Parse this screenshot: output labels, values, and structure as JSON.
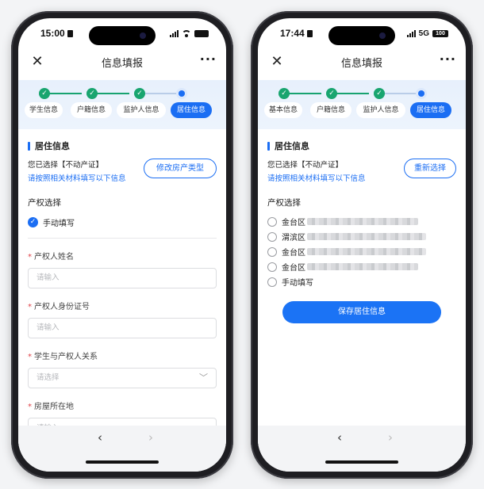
{
  "left": {
    "status": {
      "time": "15:00"
    },
    "nav": {
      "title": "信息填报"
    },
    "steps": [
      "学生信息",
      "户籍信息",
      "监护人信息",
      "居住信息"
    ],
    "section": {
      "title": "居住信息",
      "selected": "您已选择【不动产证】",
      "hint": "请按照相关材料填写以下信息",
      "action": "修改房产类型"
    },
    "property": {
      "heading": "产权选择",
      "manual": "手动填写"
    },
    "fields": [
      {
        "label": "产权人姓名",
        "placeholder": "请输入"
      },
      {
        "label": "产权人身份证号",
        "placeholder": "请输入"
      },
      {
        "label": "学生与产权人关系",
        "placeholder": "请选择"
      },
      {
        "label": "房屋所在地",
        "placeholder": "请输入"
      }
    ]
  },
  "right": {
    "status": {
      "time": "17:44",
      "network": "5G",
      "battery": "100"
    },
    "nav": {
      "title": "信息填报"
    },
    "steps": [
      "基本信息",
      "户籍信息",
      "监护人信息",
      "居住信息"
    ],
    "section": {
      "title": "居住信息",
      "selected": "您已选择【不动产证】",
      "hint": "请按照相关材料填写以下信息",
      "action": "重新选择"
    },
    "property": {
      "heading": "产权选择",
      "options": [
        "金台区",
        "渭滨区",
        "金台区",
        "金台区"
      ],
      "manual": "手动填写"
    },
    "save": "保存居住信息"
  },
  "colors": {
    "accent": "#1b6ef3",
    "done": "#19a56f",
    "required": "#e0454b"
  }
}
